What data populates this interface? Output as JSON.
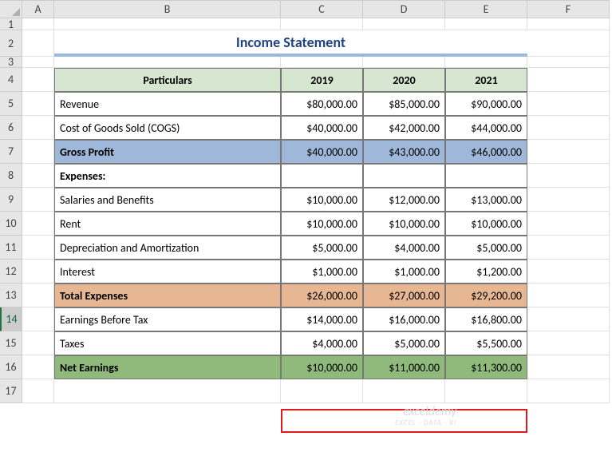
{
  "cols": [
    "A",
    "B",
    "C",
    "D",
    "E",
    "F"
  ],
  "rows": [
    "1",
    "2",
    "3",
    "4",
    "5",
    "6",
    "7",
    "8",
    "9",
    "10",
    "11",
    "12",
    "13",
    "14",
    "15",
    "16",
    "17"
  ],
  "title": "Income Statement",
  "header": {
    "particulars": "Particulars",
    "y1": "2019",
    "y2": "2020",
    "y3": "2021"
  },
  "data": {
    "revenue": {
      "label": "Revenue",
      "v1": "$80,000.00",
      "v2": "$85,000.00",
      "v3": "$90,000.00"
    },
    "cogs": {
      "label": "Cost of Goods Sold (COGS)",
      "v1": "$40,000.00",
      "v2": "$42,000.00",
      "v3": "$44,000.00"
    },
    "gross_profit": {
      "label": "Gross Profit",
      "v1": "$40,000.00",
      "v2": "$43,000.00",
      "v3": "$46,000.00"
    },
    "expenses_h": {
      "label": "Expenses:"
    },
    "salaries": {
      "label": "Salaries and Benefits",
      "v1": "$10,000.00",
      "v2": "$12,000.00",
      "v3": "$13,000.00"
    },
    "rent": {
      "label": "Rent",
      "v1": "$10,000.00",
      "v2": "$10,000.00",
      "v3": "$10,000.00"
    },
    "dep": {
      "label": "Depreciation and Amortization",
      "v1": "$5,000.00",
      "v2": "$4,000.00",
      "v3": "$5,000.00"
    },
    "interest": {
      "label": "Interest",
      "v1": "$1,000.00",
      "v2": "$1,000.00",
      "v3": "$1,200.00"
    },
    "total_exp": {
      "label": "Total Expenses",
      "v1": "$26,000.00",
      "v2": "$27,000.00",
      "v3": "$29,200.00"
    },
    "ebt": {
      "label": "Earnings Before Tax",
      "v1": "$14,000.00",
      "v2": "$16,000.00",
      "v3": "$16,800.00"
    },
    "taxes": {
      "label": "Taxes",
      "v1": "$4,000.00",
      "v2": "$5,000.00",
      "v3": "$5,500.00"
    },
    "net": {
      "label": "Net Earnings",
      "v1": "$10,000.00",
      "v2": "$11,000.00",
      "v3": "$11,300.00"
    }
  },
  "watermark": {
    "l1": "exceldemy",
    "l2": "EXCEL · DATA · BI"
  }
}
